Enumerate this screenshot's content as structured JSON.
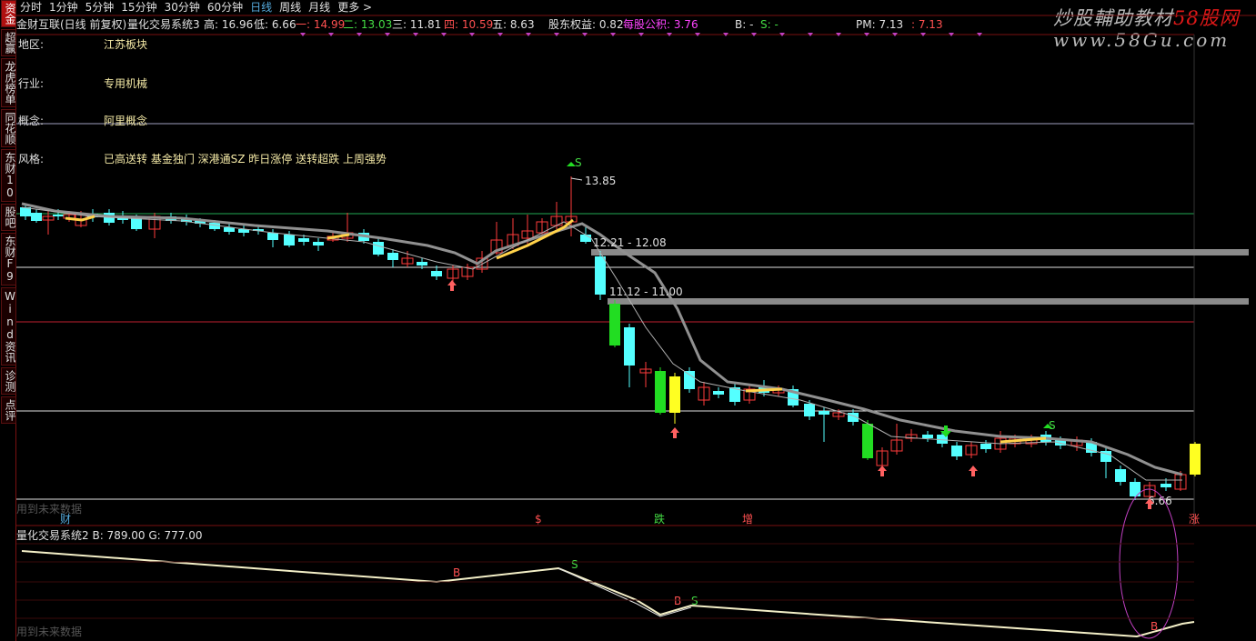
{
  "sidebar": {
    "items": [
      {
        "label": "资金",
        "active": true
      },
      {
        "label": "超赢",
        "active": false
      },
      {
        "label": "龙虎榜单",
        "active": false
      },
      {
        "label": "同花顺",
        "active": false
      },
      {
        "label": "东财10",
        "active": false
      },
      {
        "label": "股吧",
        "active": false
      },
      {
        "label": "东财F9",
        "active": false
      },
      {
        "label": "Wind资讯",
        "active": false
      },
      {
        "label": "诊测",
        "active": false
      },
      {
        "label": "点评",
        "active": false
      }
    ]
  },
  "periods": {
    "items": [
      "分时",
      "1分钟",
      "5分钟",
      "15分钟",
      "30分钟",
      "60分钟",
      "日线",
      "周线",
      "月线",
      "更多 >"
    ],
    "active": "日线"
  },
  "info": {
    "stock": "金财互联(日线 前复权)",
    "system": "量化交易系统3",
    "high": "高: 16.96",
    "low": "低: 6.66",
    "line1": "一: 14.99",
    "line2": "二: 13.03",
    "line3": "三: 11.81",
    "line4": "四: 10.59",
    "line5": "五: 8.63",
    "equity_label": "股东权益: 0.82",
    "per_share_fund": "每股公积: 3.76",
    "b_value": "B: -",
    "s_value": "S: -",
    "pm_value": "PM: 7.13",
    "pm_extra": ": 7.13"
  },
  "watermark": {
    "line1_a": "炒股輔助教材",
    "line1_b": "58股网",
    "line2": "www.58Gu.com"
  },
  "profile": [
    {
      "label": "地区:",
      "value": "江苏板块"
    },
    {
      "label": "行业:",
      "value": "专用机械"
    },
    {
      "label": "概念:",
      "value": "阿里概念"
    },
    {
      "label": "风格:",
      "value": "已高送转 基金独门 深港通SZ 昨日涨停 送转超跌 上周强势"
    }
  ],
  "annotations": {
    "price_high": "13.85",
    "zone1": "12.21 - 12.08",
    "zone2": "11.12 - 11.00",
    "price_low": "6.66",
    "signal_s": "S",
    "signal_b": "B"
  },
  "event_tags": [
    "财",
    "$",
    "跌",
    "增",
    "涨"
  ],
  "footnote_main": "用到未来数据",
  "footnote_ind": "用到未来数据",
  "indicator": {
    "title": "量化交易系统2",
    "b": "B: 789.00",
    "g": "G: 777.00"
  },
  "colors": {
    "up": "#ff3b3b",
    "down": "#54ffff",
    "green": "#22dd22",
    "yellow": "#ffff22",
    "ma": "#909090"
  }
}
